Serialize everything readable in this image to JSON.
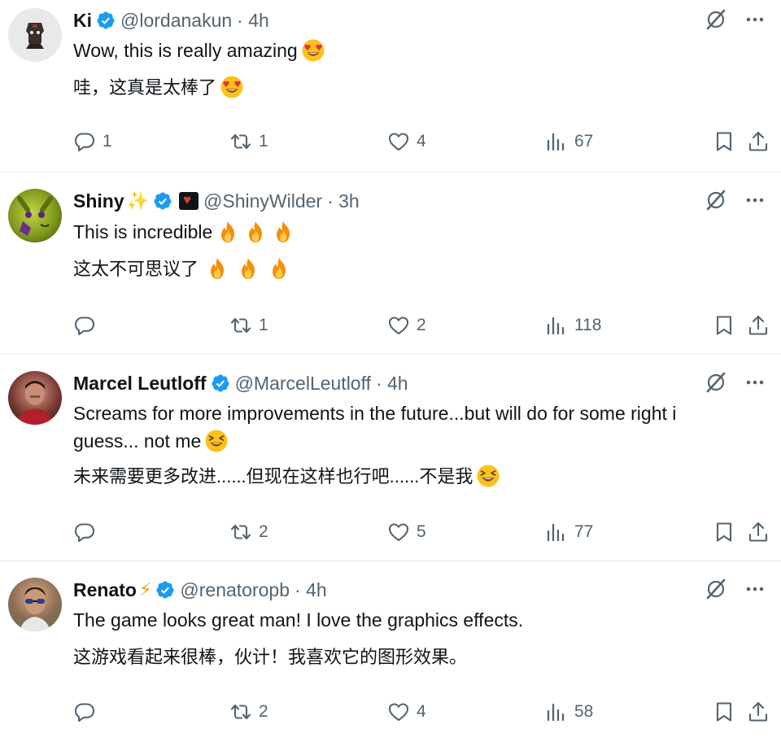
{
  "replies": [
    {
      "name": "Ki",
      "handle": "@lordanakun",
      "time": "· 4h",
      "name_emoji": "",
      "text_en": "Wow, this is really amazing",
      "text_en_2": "",
      "text_zh": "哇，这真是太棒了",
      "emoji": "heart-eyes-face",
      "replies": "1",
      "reposts": "1",
      "likes": "4",
      "views": "67"
    },
    {
      "name": "Shiny",
      "handle": "@ShinyWilder",
      "time": "· 3h",
      "name_emoji": "✨",
      "text_en": "This is incredible",
      "text_en_2": "",
      "text_zh": "这太不可思议了",
      "emoji": "fire",
      "replies": "",
      "reposts": "1",
      "likes": "2",
      "views": "118"
    },
    {
      "name": "Marcel Leutloff",
      "handle": "@MarcelLeutloff",
      "time": "· 4h",
      "name_emoji": "",
      "text_en": "Screams for more improvements in the future...but will do for some right i",
      "text_en_2": "guess... not me",
      "text_zh": "未来需要更多改进......但现在这样也行吧......不是我",
      "emoji": "laughing-face",
      "replies": "",
      "reposts": "2",
      "likes": "5",
      "views": "77"
    },
    {
      "name": "Renato",
      "handle": "@renatoropb",
      "time": "· 4h",
      "name_emoji": "⚡",
      "text_en": "The game looks great man! I love the graphics effects.",
      "text_en_2": "",
      "text_zh": "这游戏看起来很棒，伙计！我喜欢它的图形效果。",
      "emoji": "",
      "replies": "",
      "reposts": "2",
      "likes": "4",
      "views": "58"
    }
  ],
  "colors": {
    "text": "#0f1419",
    "secondary": "#536471",
    "verified": "#1d9bf0",
    "divider": "#e6ecf0"
  }
}
